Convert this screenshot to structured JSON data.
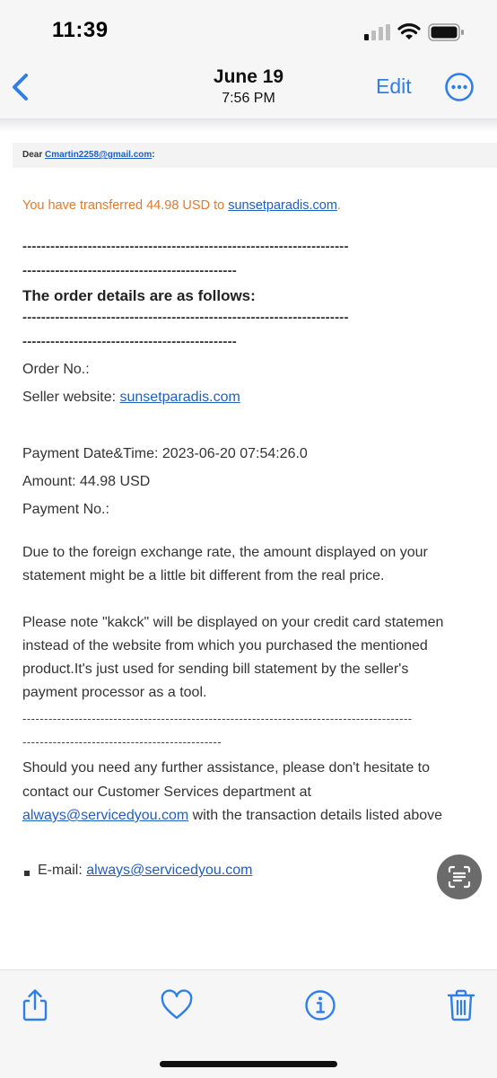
{
  "status_bar": {
    "time": "11:39"
  },
  "nav": {
    "date": "June 19",
    "time": "7:56 PM",
    "edit_label": "Edit"
  },
  "email": {
    "dear_prefix": "Dear ",
    "dear_email": "Cmartin2258@gmail.com",
    "dear_suffix": ":",
    "transfer_prefix": "You have transferred 44.98 USD to ",
    "transfer_link": "sunsetparadis.com",
    "transfer_suffix": ".",
    "dash_line_long": "----------------------------------------------------------------------",
    "dash_line_short": "----------------------------------------------",
    "dash_line_long2": "------------------------------------------------------------------------------------------",
    "dash_line_short2": "----------------------------------------------",
    "order_heading": "The order details are as follows:",
    "order_no_label": "Order No.:",
    "seller_label": "Seller website: ",
    "seller_link": "sunsetparadis.com",
    "payment_datetime": "Payment Date&Time: 2023-06-20 07:54:26.0",
    "amount": "Amount: 44.98 USD",
    "payment_no_label": "Payment No.:",
    "fx_line1": "Due to the foreign exchange rate, the amount displayed on your",
    "fx_line2": "statement might be a little bit different from the real price.",
    "note_line1": "Please note \"kakck\" will be displayed on your credit card statemen",
    "note_line2": "instead of the website from which you purchased the mentioned",
    "note_line3": "product.It's just used for sending bill statement by the seller's",
    "note_line4": "payment processor as a tool.",
    "help_line1": "Should you need any further assistance, please don't hesitate to",
    "help_line2": "contact our Customer Services department at",
    "help_link": "always@servicedyou.com",
    "help_line3_suffix": " with the transaction details listed above",
    "email_label": "E-mail: ",
    "email_link": "always@servicedyou.com"
  },
  "toolbar": {
    "icons": [
      "share-icon",
      "heart-icon",
      "info-icon",
      "trash-icon"
    ]
  },
  "colors": {
    "accent": "#2f7fe8",
    "link": "#1f5fbf",
    "orange": "#e27a2d"
  }
}
